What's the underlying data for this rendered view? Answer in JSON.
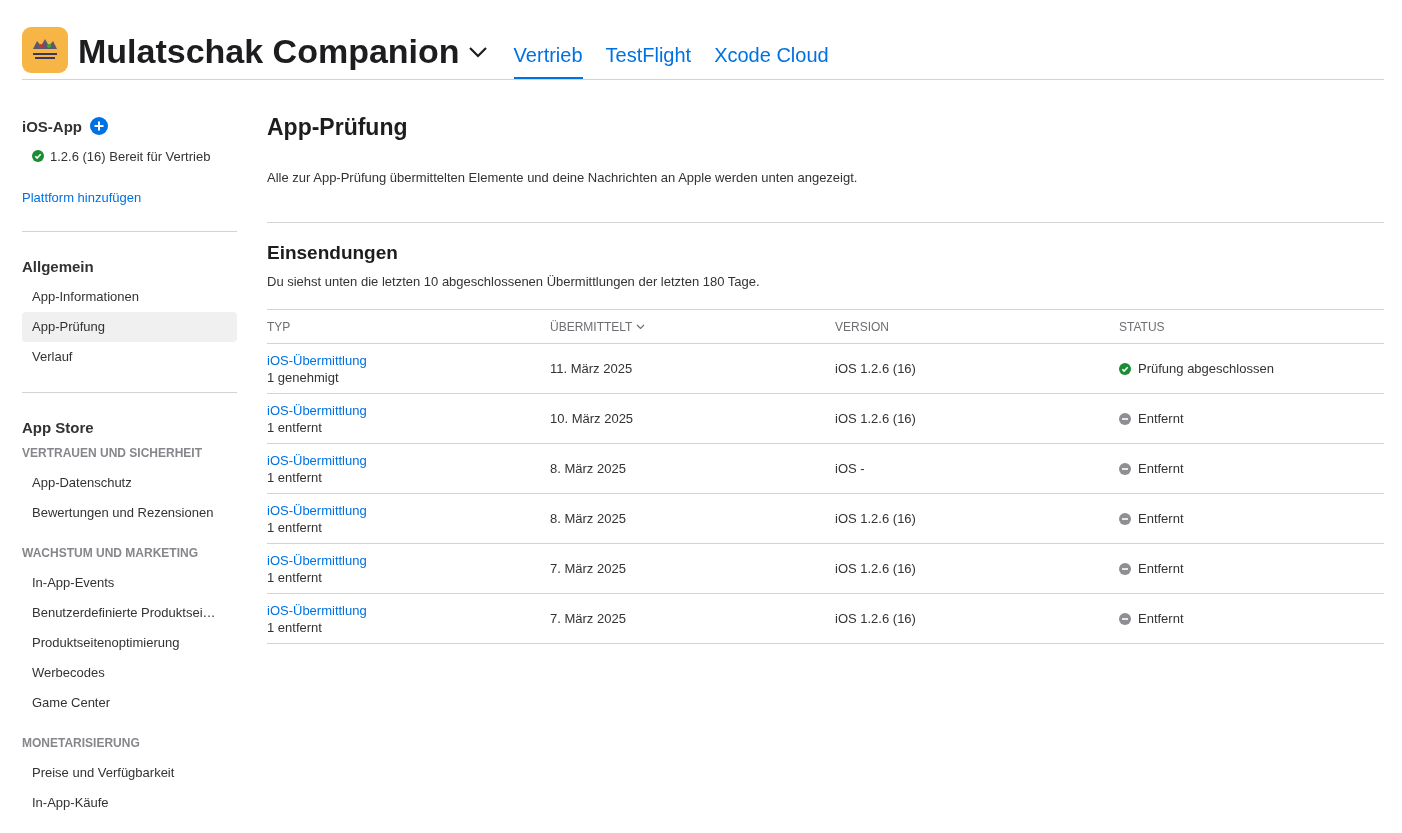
{
  "header": {
    "app_name": "Mulatschak Companion",
    "tabs": [
      {
        "label": "Vertrieb",
        "selected": true
      },
      {
        "label": "TestFlight",
        "selected": false
      },
      {
        "label": "Xcode Cloud",
        "selected": false
      }
    ]
  },
  "sidebar": {
    "platform": {
      "title": "iOS-App",
      "version": "1.2.6 (16) Bereit für Vertrieb",
      "kind": "ready"
    },
    "add_platform": "Plattform hinzufügen",
    "sections": [
      {
        "title": "Allgemein",
        "groups": [
          {
            "items": [
              {
                "label": "App-Informationen",
                "selected": false
              },
              {
                "label": "App-Prüfung",
                "selected": true
              },
              {
                "label": "Verlauf",
                "selected": false
              }
            ]
          }
        ]
      },
      {
        "title": "App Store",
        "groups": [
          {
            "heading": "VERTRAUEN UND SICHERHEIT",
            "items": [
              {
                "label": "App-Datenschutz",
                "selected": false
              },
              {
                "label": "Bewertungen und Rezensionen",
                "selected": false
              }
            ]
          },
          {
            "heading": "WACHSTUM UND MARKETING",
            "items": [
              {
                "label": "In-App-Events",
                "selected": false
              },
              {
                "label": "Benutzerdefinierte Produktsei…",
                "selected": false
              },
              {
                "label": "Produktseitenoptimierung",
                "selected": false
              },
              {
                "label": "Werbecodes",
                "selected": false
              },
              {
                "label": "Game Center",
                "selected": false
              }
            ]
          },
          {
            "heading": "MONETARISIERUNG",
            "items": [
              {
                "label": "Preise und Verfügbarkeit",
                "selected": false
              },
              {
                "label": "In-App-Käufe",
                "selected": false
              }
            ]
          }
        ]
      }
    ]
  },
  "main": {
    "title": "App-Prüfung",
    "description": "Alle zur App-Prüfung übermittelten Elemente und deine Nachrichten an Apple werden unten angezeigt.",
    "section_title": "Einsendungen",
    "section_subtitle": "Du siehst unten die letzten 10 abgeschlossenen Übermittlungen der letzten 180 Tage.",
    "table": {
      "columns": [
        {
          "label": "TYP",
          "sorted": false
        },
        {
          "label": "ÜBERMITTELT",
          "sorted": true
        },
        {
          "label": "VERSION",
          "sorted": false
        },
        {
          "label": "STATUS",
          "sorted": false
        }
      ],
      "rows": [
        {
          "type": "iOS-Übermittlung",
          "detail": "1 genehmigt",
          "date": "11. März 2025",
          "version": "iOS 1.2.6 (16)",
          "status": "Prüfung abgeschlossen",
          "kind": "approved"
        },
        {
          "type": "iOS-Übermittlung",
          "detail": "1 entfernt",
          "date": "10. März 2025",
          "version": "iOS 1.2.6 (16)",
          "status": "Entfernt",
          "kind": "removed"
        },
        {
          "type": "iOS-Übermittlung",
          "detail": "1 entfernt",
          "date": "8. März 2025",
          "version": "iOS -",
          "status": "Entfernt",
          "kind": "removed"
        },
        {
          "type": "iOS-Übermittlung",
          "detail": "1 entfernt",
          "date": "8. März 2025",
          "version": "iOS 1.2.6 (16)",
          "status": "Entfernt",
          "kind": "removed"
        },
        {
          "type": "iOS-Übermittlung",
          "detail": "1 entfernt",
          "date": "7. März 2025",
          "version": "iOS 1.2.6 (16)",
          "status": "Entfernt",
          "kind": "removed"
        },
        {
          "type": "iOS-Übermittlung",
          "detail": "1 entfernt",
          "date": "7. März 2025",
          "version": "iOS 1.2.6 (16)",
          "status": "Entfernt",
          "kind": "removed"
        }
      ]
    }
  }
}
